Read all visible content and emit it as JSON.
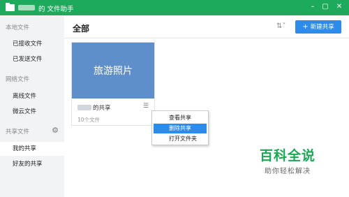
{
  "titlebar": {
    "title": "的 文件助手",
    "icons": {
      "folder": "folder-icon"
    }
  },
  "sidebar": {
    "sections": {
      "local": "本地文件",
      "network": "网络文件",
      "shared": "共享文件"
    },
    "items": [
      {
        "label": "已接收文件"
      },
      {
        "label": "已发送文件"
      },
      {
        "label": "离线文件"
      },
      {
        "label": "微云文件"
      },
      {
        "label": "我的共享",
        "active": true
      },
      {
        "label": "好友的共享"
      }
    ],
    "gear_icon": "gear-icon"
  },
  "main": {
    "heading": "全部",
    "sort_icon": "sort-icon",
    "new_share_label": "新建共享",
    "card": {
      "thumb_text": "旅游照片",
      "name": "的共享",
      "count": "10个文件",
      "menu_icon": "menu-icon"
    },
    "context_menu": [
      {
        "label": "查看共享"
      },
      {
        "label": "删除共享",
        "highlighted": true
      },
      {
        "label": "打开文件夹"
      }
    ]
  },
  "watermark": {
    "title": "百科全说",
    "subtitle": "助你轻松解决"
  },
  "colors": {
    "titlebar": "#1eaa5d",
    "accent": "#2d8ceb",
    "thumb": "#5f8fcb",
    "watermark": "#1aa855"
  }
}
